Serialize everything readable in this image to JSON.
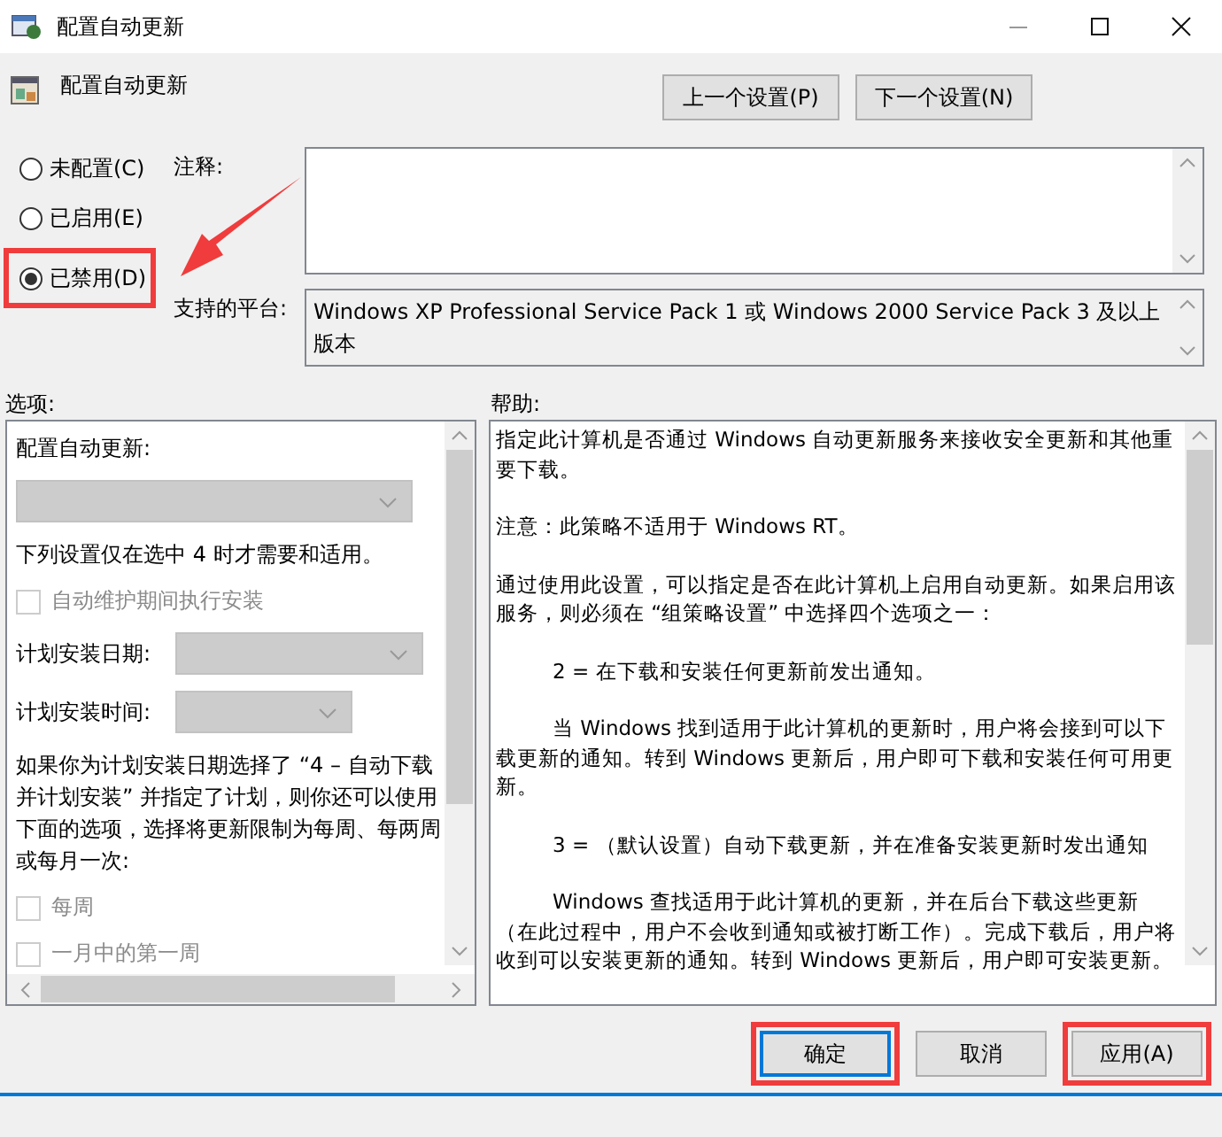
{
  "window": {
    "title": "配置自动更新"
  },
  "header": {
    "title": "配置自动更新",
    "prev_button": "上一个设置(P)",
    "next_button": "下一个设置(N)"
  },
  "state_options": [
    {
      "label": "未配置(C)",
      "selected": false,
      "highlighted": false
    },
    {
      "label": "已启用(E)",
      "selected": false,
      "highlighted": false
    },
    {
      "label": "已禁用(D)",
      "selected": true,
      "highlighted": true
    }
  ],
  "callout_arrow": true,
  "comment": {
    "label": "注释:"
  },
  "platform": {
    "label": "支持的平台:",
    "value": "Windows XP Professional Service Pack 1 或 Windows 2000 Service Pack 3 及以上版本"
  },
  "options": {
    "label": "选项:",
    "items": [
      {
        "kind": "label",
        "text": "配置自动更新:"
      },
      {
        "kind": "dropdown",
        "disabled": true
      },
      {
        "kind": "label",
        "text": "下列设置仅在选中 4 时才需要和适用。"
      },
      {
        "kind": "checkbox",
        "text": "自动维护期间执行安装",
        "checked": false,
        "disabled": true
      },
      {
        "kind": "field",
        "text": "计划安装日期:",
        "disabled": true
      },
      {
        "kind": "field",
        "text": "计划安装时间:",
        "disabled": true
      },
      {
        "kind": "label",
        "text": "如果你为计划安装日期选择了 “4 – 自动下载并计划安装” 并指定了计划，则你还可以使用下面的选项，选择将更新限制为每周、每两周或每月一次:"
      },
      {
        "kind": "checkbox",
        "text": "每周",
        "checked": false,
        "disabled": true
      },
      {
        "kind": "checkbox",
        "text": "一月中的第一周",
        "checked": false,
        "disabled": true
      }
    ]
  },
  "help": {
    "label": "帮助:",
    "paragraphs": [
      {
        "kind": "plain",
        "text": "指定此计算机是否通过 Windows 自动更新服务来接收安全更新和其他重要下载。"
      },
      {
        "kind": "plain",
        "text": "注意：此策略不适用于 Windows RT。"
      },
      {
        "kind": "plain",
        "text": "通过使用此设置，可以指定是否在此计算机上启用自动更新。如果启用该服务，则必须在 “组策略设置” 中选择四个选项之一："
      },
      {
        "kind": "indented",
        "text": "2 = 在下载和安装任何更新前发出通知。"
      },
      {
        "kind": "indented",
        "text": "当 Windows 找到适用于此计算机的更新时，用户将会接到可以下载更新的通知。转到 Windows 更新后，用户即可下载和安装任何可用更新。"
      },
      {
        "kind": "indented",
        "text": "3 = （默认设置）自动下载更新，并在准备安装更新时发出通知"
      },
      {
        "kind": "indented",
        "text": "Windows 查找适用于此计算机的更新，并在后台下载这些更新（在此过程中，用户不会收到通知或被打断工作）。完成下载后，用户将收到可以安装更新的通知。转到 Windows 更新后，用户即可安装更新。"
      }
    ]
  },
  "buttons": [
    {
      "label": "确定",
      "default": true,
      "highlighted": true
    },
    {
      "label": "取消",
      "default": false,
      "highlighted": false
    },
    {
      "label": "应用(A)",
      "default": false,
      "highlighted": true
    }
  ]
}
